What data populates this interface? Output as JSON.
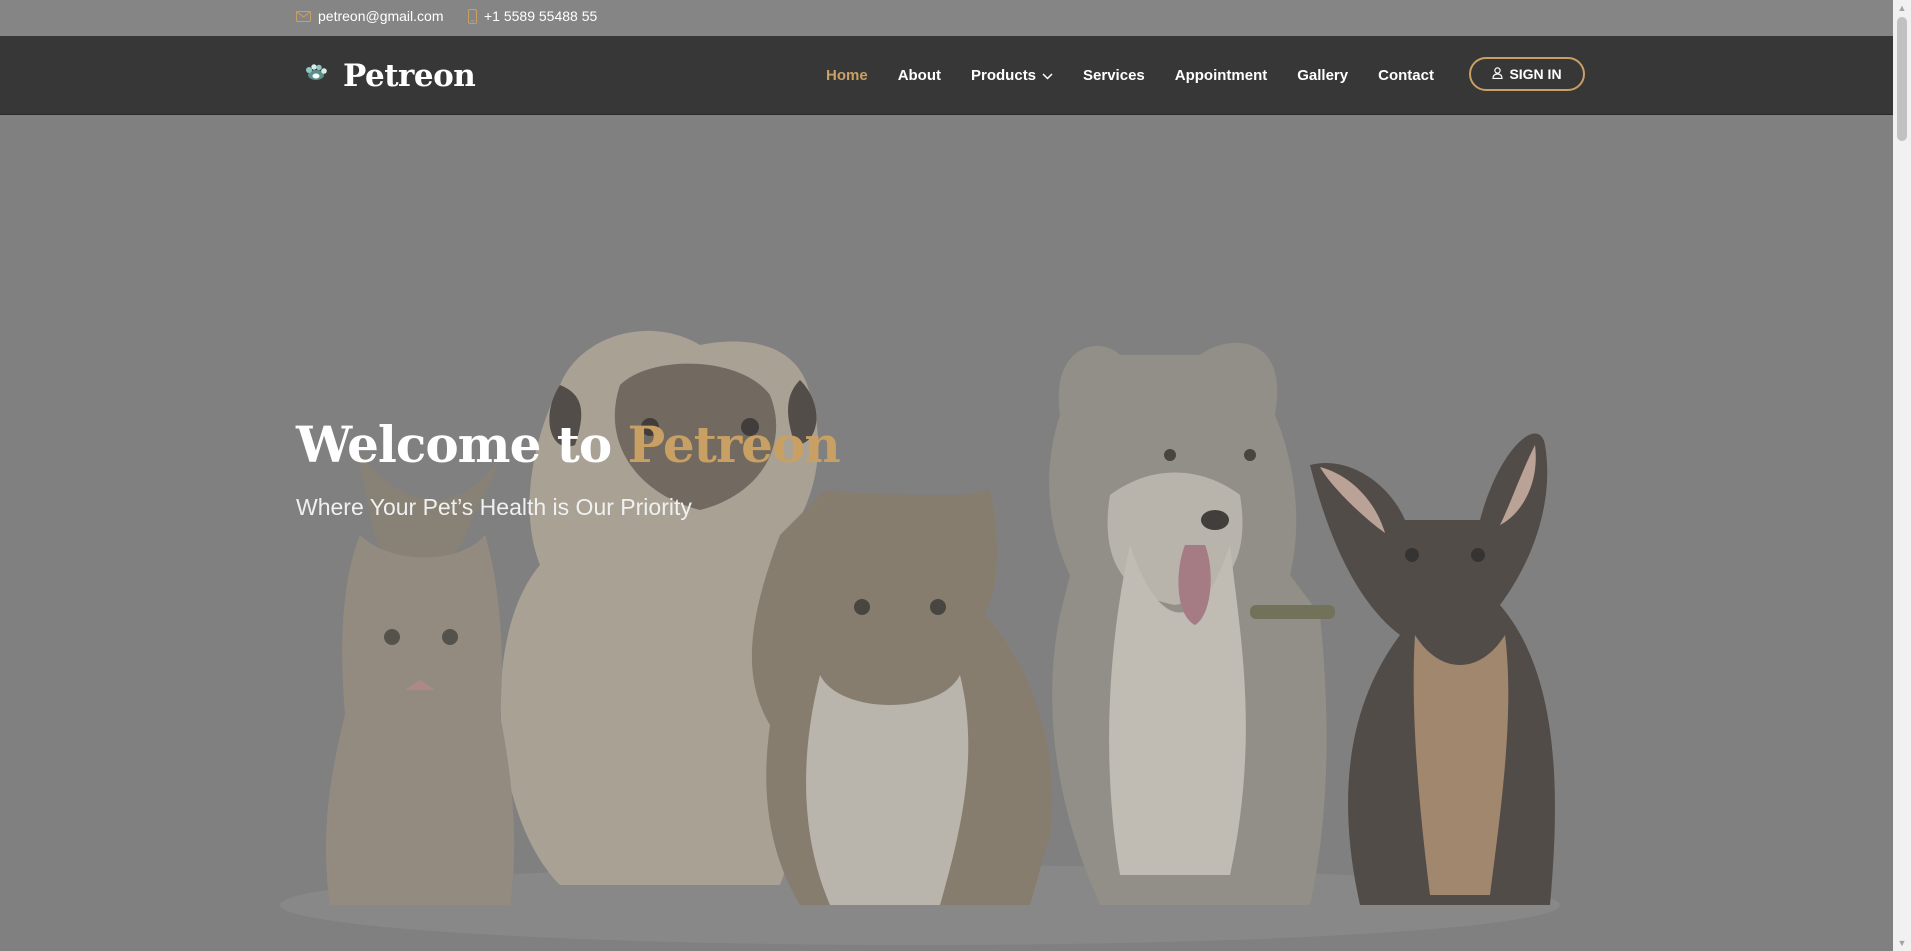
{
  "topbar": {
    "email": "petreon@gmail.com",
    "phone": "+1 5589 55488 55",
    "email_icon": "envelope-icon",
    "phone_icon": "phone-icon"
  },
  "brand": {
    "name": "Petreon",
    "logo_icon": "paw-logo-icon"
  },
  "nav": {
    "items": [
      {
        "label": "Home",
        "active": true
      },
      {
        "label": "About"
      },
      {
        "label": "Products",
        "has_dropdown": true
      },
      {
        "label": "Services"
      },
      {
        "label": "Appointment"
      },
      {
        "label": "Gallery"
      },
      {
        "label": "Contact"
      }
    ],
    "signin_label": "SIGN IN",
    "signin_icon": "user-icon"
  },
  "hero": {
    "title_prefix": "Welcome to ",
    "title_accent": "Petreon",
    "subtitle": "Where Your Pet’s Health is Our Priority",
    "image_subject": "kitten, pug, long-haired cat, husky dog, chihuahua puppy"
  },
  "colors": {
    "accent": "#c9a063",
    "header_bg": "#373737",
    "overlay_bg": "#808080"
  }
}
